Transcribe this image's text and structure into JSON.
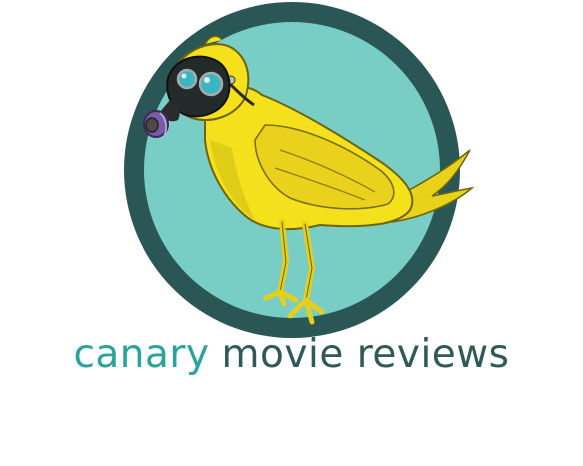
{
  "brand": {
    "word_canary": "canary",
    "word_rest": "movie reviews",
    "color_canary": "#2aa39a",
    "color_rest": "#2f5a57"
  },
  "logo": {
    "icon": "canary-gas-mask-icon",
    "circle_outer_color": "#2a5755",
    "circle_inner_color": "#78cec4",
    "bird_color": "#f4e11b",
    "mask_color": "#222a2a",
    "lens_color": "#38b7c2",
    "filter_color": "#7b5aa6"
  }
}
